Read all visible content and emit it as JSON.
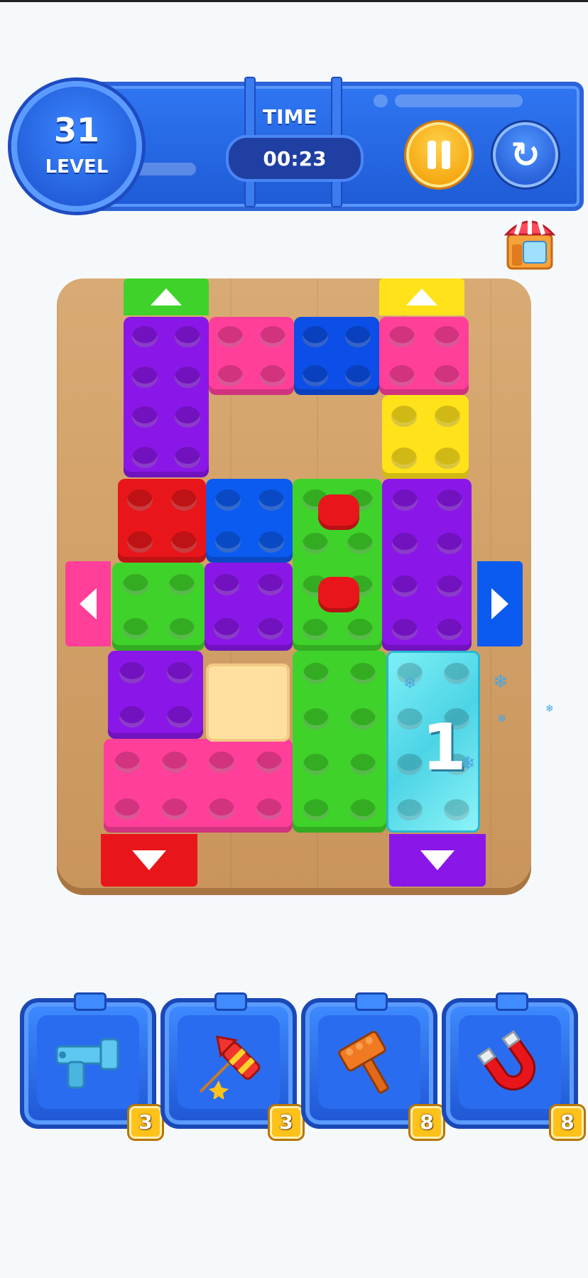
{
  "hud": {
    "level_number": "31",
    "level_label": "LEVEL",
    "time_label": "TIME",
    "time_value": "00:23"
  },
  "icons": {
    "pause": "pause-icon",
    "restart": "restart-icon",
    "shop": "shop-icon",
    "gun": "toy-gun-icon",
    "rocket": "firework-rocket-icon",
    "hammer": "brick-hammer-icon",
    "magnet": "magnet-icon"
  },
  "board": {
    "gates": [
      {
        "name": "green-up-gate",
        "color": "#3fd22a",
        "dir": "up"
      },
      {
        "name": "yellow-up-gate",
        "color": "#ffe21a",
        "dir": "up"
      },
      {
        "name": "pink-left-gate",
        "color": "#ff3f9a",
        "dir": "left"
      },
      {
        "name": "blue-right-gate",
        "color": "#0b5bf0",
        "dir": "right"
      },
      {
        "name": "red-down-gate",
        "color": "#e8161a",
        "dir": "down"
      },
      {
        "name": "purple-down-gate",
        "color": "#8a17e8",
        "dir": "down"
      }
    ],
    "blocks": [
      {
        "color": "purple",
        "hex": "#8a17e8"
      },
      {
        "color": "pink",
        "hex": "#ff3f9a"
      },
      {
        "color": "blue",
        "hex": "#0b4fe8"
      },
      {
        "color": "pink",
        "hex": "#ff3f9a"
      },
      {
        "color": "yellow",
        "hex": "#ffe21a"
      },
      {
        "color": "red",
        "hex": "#e8161a"
      },
      {
        "color": "blue",
        "hex": "#0b5bf0"
      },
      {
        "color": "green",
        "hex": "#3fd22a"
      },
      {
        "color": "purple",
        "hex": "#8a17e8"
      },
      {
        "color": "green",
        "hex": "#3fd22a"
      },
      {
        "color": "purple",
        "hex": "#8a17e8"
      },
      {
        "color": "purple",
        "hex": "#8a17e8"
      },
      {
        "color": "green",
        "hex": "#3fd22a"
      },
      {
        "color": "frozen",
        "hex": "#5fe3ef"
      },
      {
        "color": "pink",
        "hex": "#ff3f9a"
      },
      {
        "color": "empty-slot",
        "hex": "#ffe0a0"
      }
    ],
    "frozen_count": "1"
  },
  "powerups": [
    {
      "name": "gun",
      "count": "3"
    },
    {
      "name": "rocket",
      "count": "3"
    },
    {
      "name": "hammer",
      "count": "8"
    },
    {
      "name": "magnet",
      "count": "8"
    }
  ]
}
